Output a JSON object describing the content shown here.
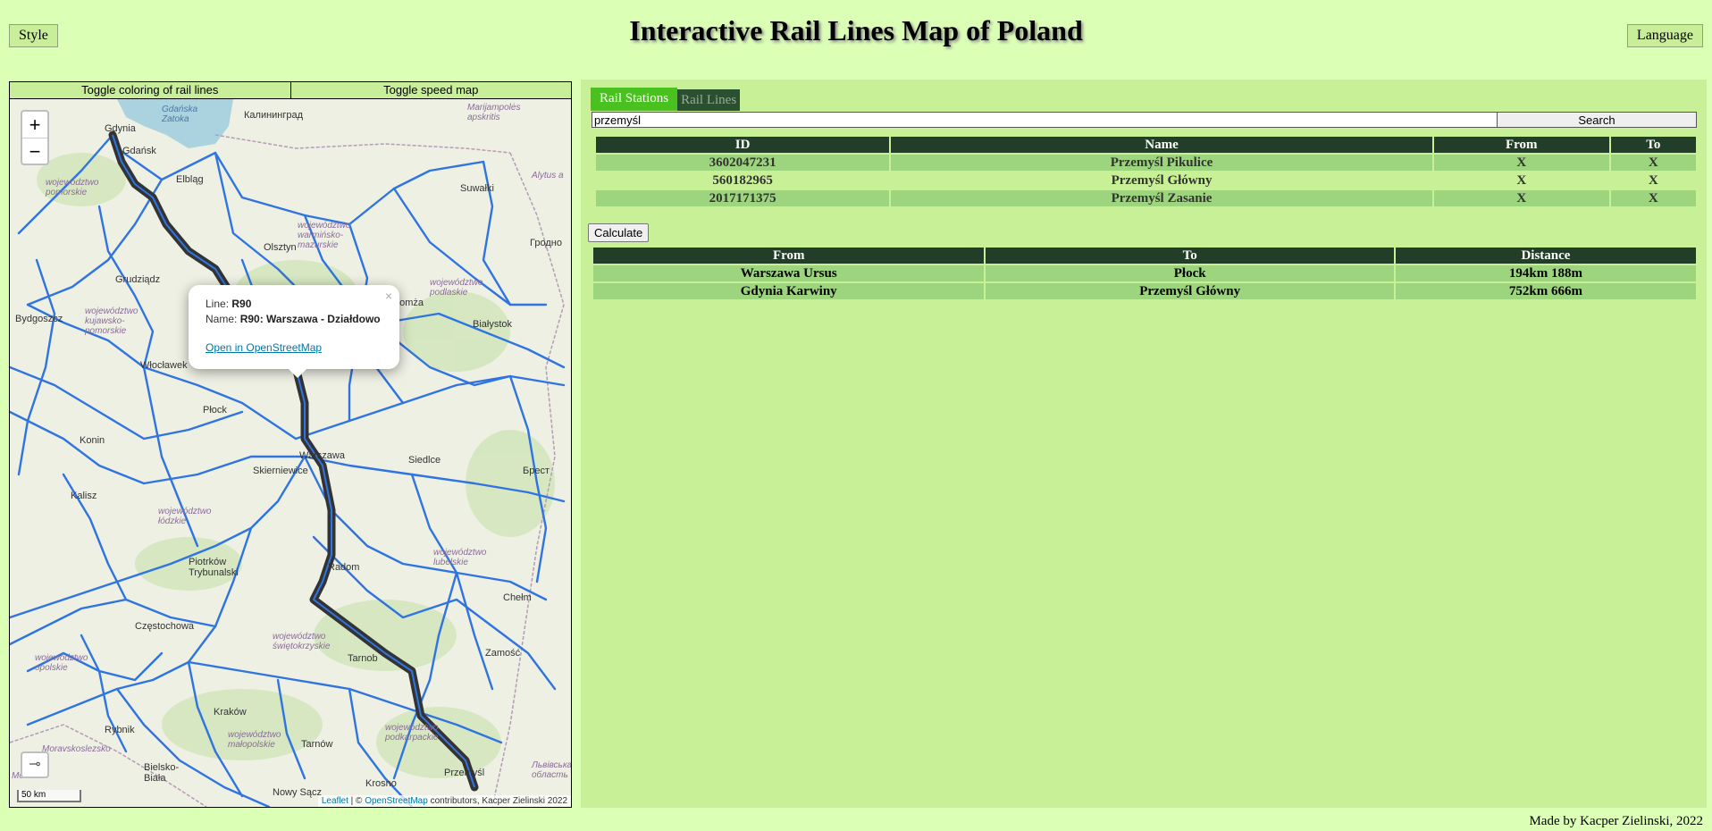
{
  "header": {
    "title": "Interactive Rail Lines Map of Poland",
    "style_label": "Style",
    "language_label": "Language"
  },
  "map": {
    "toggle_coloring": "Toggle coloring of rail lines",
    "toggle_speed": "Toggle speed map",
    "zoom_in": "+",
    "zoom_out": "−",
    "scale": "50 km",
    "attribution": {
      "leaflet": "Leaflet",
      "sep": " | © ",
      "osm": "OpenStreetMap",
      "rest": " contributors, Kacper Zielinski 2022"
    },
    "popup": {
      "line_label": "Line:",
      "line_value": "R90",
      "name_label": "Name:",
      "name_value": "R90: Warszawa - Działdowo",
      "link": "Open in OpenStreetMap",
      "close": "×"
    },
    "labels": {
      "kaliningrad": "Калининград",
      "marijampole": "Marijampolės apskritis",
      "gdansk_bay": "Gdańska Zatoka",
      "gdynia": "Gdynia",
      "gdansk": "Gdańsk",
      "elblag": "Elbląg",
      "suwalki": "Suwałki",
      "alytus": "Alytus a",
      "grodno": "Гродно",
      "pomorskie": "województwo pomorskie",
      "warminsko": "województwo warmińsko-mazurskie",
      "olsztyn": "Olsztyn",
      "grudziadz": "Grudziądz",
      "bydgoszcz": "Bydgoszcz",
      "kujawsko": "województwo kujawsko-pomorskie",
      "podlaskie": "województwo podlaskie",
      "lomza": "Łomża",
      "bialystok": "Białystok",
      "wloclawek": "Włocławek",
      "plock": "Płock",
      "konin": "Konin",
      "warszawa": "Warszawa",
      "siedlce": "Siedlce",
      "brest": "Брест",
      "skierniewice": "Skierniewice",
      "kalisz": "Kalisz",
      "lodzkie": "województwo łódzkie",
      "radom": "Radom",
      "piotrkow": "Piotrków Trybunalski",
      "lubelskie": "województwo lubelskie",
      "chelm": "Chełm",
      "czestochowa": "Częstochowa",
      "swietokrzyskie": "województwo świętokrzyskie",
      "opolskie": "województwo opolskie",
      "tarnobrzeg": "Tarnob",
      "zamosc": "Zamość",
      "krakow": "Kraków",
      "tarnow": "Tarnów",
      "malopolskie": "województwo małopolskie",
      "podkarpackie": "województwo podkarpackie",
      "przemysl": "Przemyśl",
      "morav": "Moravskoslezsko",
      "bielsko": "Bielsko-Biała",
      "nowy_sacz": "Nowy Sącz",
      "krosno": "Krosno",
      "lviv": "Львівська область",
      "rybnik": "Rybnik",
      "morava": "Morava"
    }
  },
  "tabs": {
    "stations": "Rail Stations",
    "lines": "Rail Lines"
  },
  "search": {
    "value": "przemyśl",
    "button": "Search"
  },
  "stations_table": {
    "headers": [
      "ID",
      "Name",
      "From",
      "To"
    ],
    "rows": [
      [
        "3602047231",
        "Przemyśl Pikulice",
        "X",
        "X"
      ],
      [
        "560182965",
        "Przemyśl Główny",
        "X",
        "X"
      ],
      [
        "2017171375",
        "Przemyśl Zasanie",
        "X",
        "X"
      ]
    ]
  },
  "calculate_label": "Calculate",
  "routes_table": {
    "headers": [
      "From",
      "To",
      "Distance"
    ],
    "rows": [
      [
        "Warszawa Ursus",
        "Płock",
        "194km 188m"
      ],
      [
        "Gdynia Karwiny",
        "Przemyśl Główny",
        "752km 666m"
      ]
    ]
  },
  "footer": "Made by Kacper Zielinski, 2022",
  "colors": {
    "page_bg": "#dcffb6",
    "panel_bg": "#c8f096",
    "header_cell": "#223e28",
    "row_cell": "#9cd57e",
    "active_tab": "#49c21f",
    "rail_line": "#2f74e0",
    "route_line": "#333333"
  }
}
